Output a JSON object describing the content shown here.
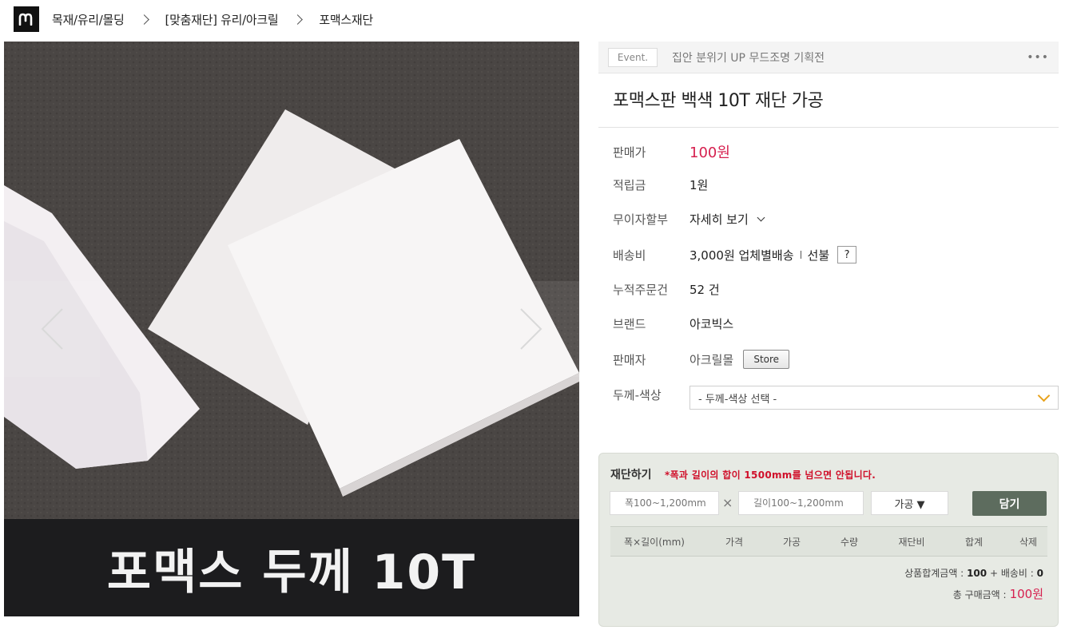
{
  "breadcrumb": {
    "logo": "m-logo-icon",
    "items": [
      "목재/유리/몰딩",
      "[맞춤재단] 유리/아크릴",
      "포맥스재단"
    ]
  },
  "image": {
    "caption": "포맥스 두께 10T"
  },
  "event": {
    "badge": "Event.",
    "text": "집안 분위기 UP 무드조명 기획전",
    "more": "•••"
  },
  "product": {
    "title": "포맥스판 백색 10T 재단 가공",
    "price_label": "판매가",
    "price": "100원",
    "points_label": "적립금",
    "points": "1원",
    "installment_label": "무이자할부",
    "installment": "자세히 보기",
    "shipping_label": "배송비",
    "shipping_fee": "3,000원 업체별배송",
    "shipping_type": "선불",
    "shipping_help": "?",
    "orders_label": "누적주문건",
    "orders": "52 건",
    "brand_label": "브랜드",
    "brand": "아코빅스",
    "seller_label": "판매자",
    "seller": "아크릴몰",
    "store_btn": "Store",
    "option_label": "두께-색상",
    "option_placeholder": "- 두께-색상 선택 -"
  },
  "cut": {
    "title": "재단하기",
    "note": "*폭과 길이의 합이 1500mm를 넘으면 안됩니다.",
    "width_placeholder": "폭100~1,200mm",
    "times": "×",
    "length_placeholder": "길이100~1,200mm",
    "process": "가공 ▼",
    "add": "담기",
    "columns": [
      "폭×길이(mm)",
      "가격",
      "가공",
      "수량",
      "재단비",
      "합계",
      "삭제"
    ],
    "subtotal_label": "상품합계금액 :",
    "subtotal": "100",
    "shipping_part": "+ 배송비 :",
    "shipping": "0",
    "total_label": "총 구매금액 :",
    "total": "100원"
  },
  "colors": {
    "accent_price": "#d6204f",
    "add_button": "#5d6c5e",
    "select_chevron": "#e8a21b"
  }
}
